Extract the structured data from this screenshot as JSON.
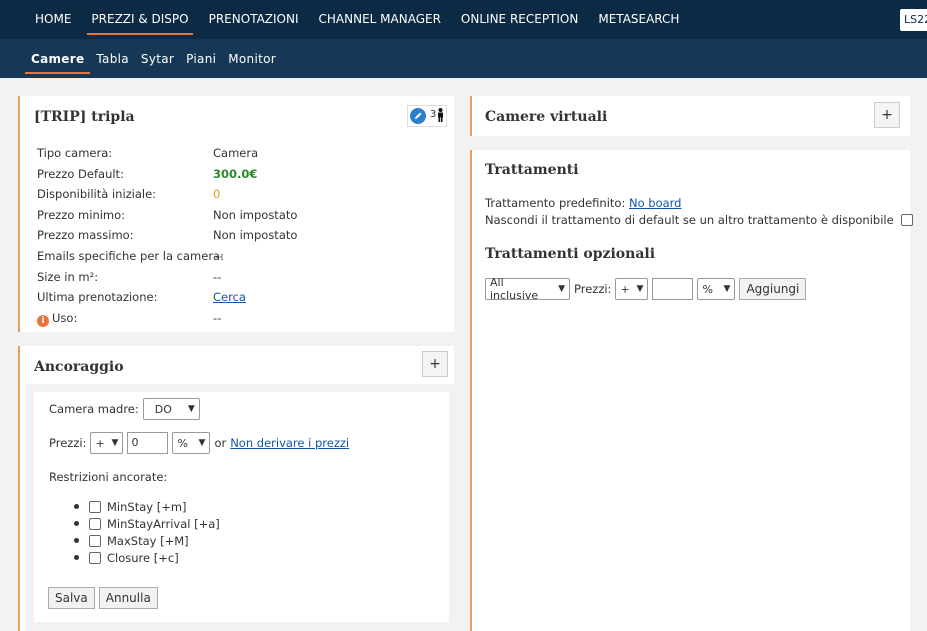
{
  "topnav": {
    "items": [
      "HOME",
      "PREZZI & DISPO",
      "PRENOTAZIONI",
      "CHANNEL MANAGER",
      "ONLINE RECEPTION",
      "METASEARCH"
    ],
    "badge": "LS22"
  },
  "subnav": {
    "items": [
      "Camere",
      "Tabla",
      "Sytar",
      "Piani",
      "Monitor"
    ]
  },
  "room": {
    "title": "[TRIP] tripla",
    "occupancy": "3",
    "props": [
      {
        "label": "Tipo camera:",
        "value": "Camera"
      },
      {
        "label": "Prezzo Default:",
        "value": "300.0€"
      },
      {
        "label": "Disponibilità iniziale:",
        "value": "0"
      },
      {
        "label": "Prezzo minimo:",
        "value": "Non impostato"
      },
      {
        "label": "Prezzo massimo:",
        "value": "Non impostato"
      },
      {
        "label": "Emails specifiche per la camera:",
        "value": "--"
      },
      {
        "label": "Size in m²:",
        "value": "--"
      },
      {
        "label": "Ultima prenotazione:",
        "value": "Cerca"
      },
      {
        "label": "Uso:",
        "value": "--"
      }
    ]
  },
  "virtual": {
    "title": "Camere virtuali",
    "add": "+"
  },
  "treatments": {
    "title": "Trattamenti",
    "default_label": "Trattamento predefinito:",
    "default_value": "No board",
    "hide_label": "Nascondi il trattamento di default se un altro trattamento è disponibile",
    "optional_title": "Trattamenti opzionali",
    "treatment_select": "All inclusive",
    "prices_label": "Prezzi:",
    "sign_select": "+",
    "amount_value": "",
    "unit_select": "%",
    "add_button": "Aggiungi"
  },
  "anchor": {
    "title": "Ancoraggio",
    "add": "+",
    "mother_label": "Camera madre:",
    "mother_select": "DO",
    "prices_label": "Prezzi:",
    "sign_select": "+",
    "amount_value": "0",
    "unit_select": "%",
    "or_text": "or",
    "no_derive_link": "Non derivare i prezzi",
    "restrictions_label": "Restrizioni ancorate:",
    "restrictions": [
      "MinStay [+m]",
      "MinStayArrival [+a]",
      "MaxStay [+M]",
      "Closure [+c]"
    ],
    "save": "Salva",
    "cancel": "Annulla"
  }
}
